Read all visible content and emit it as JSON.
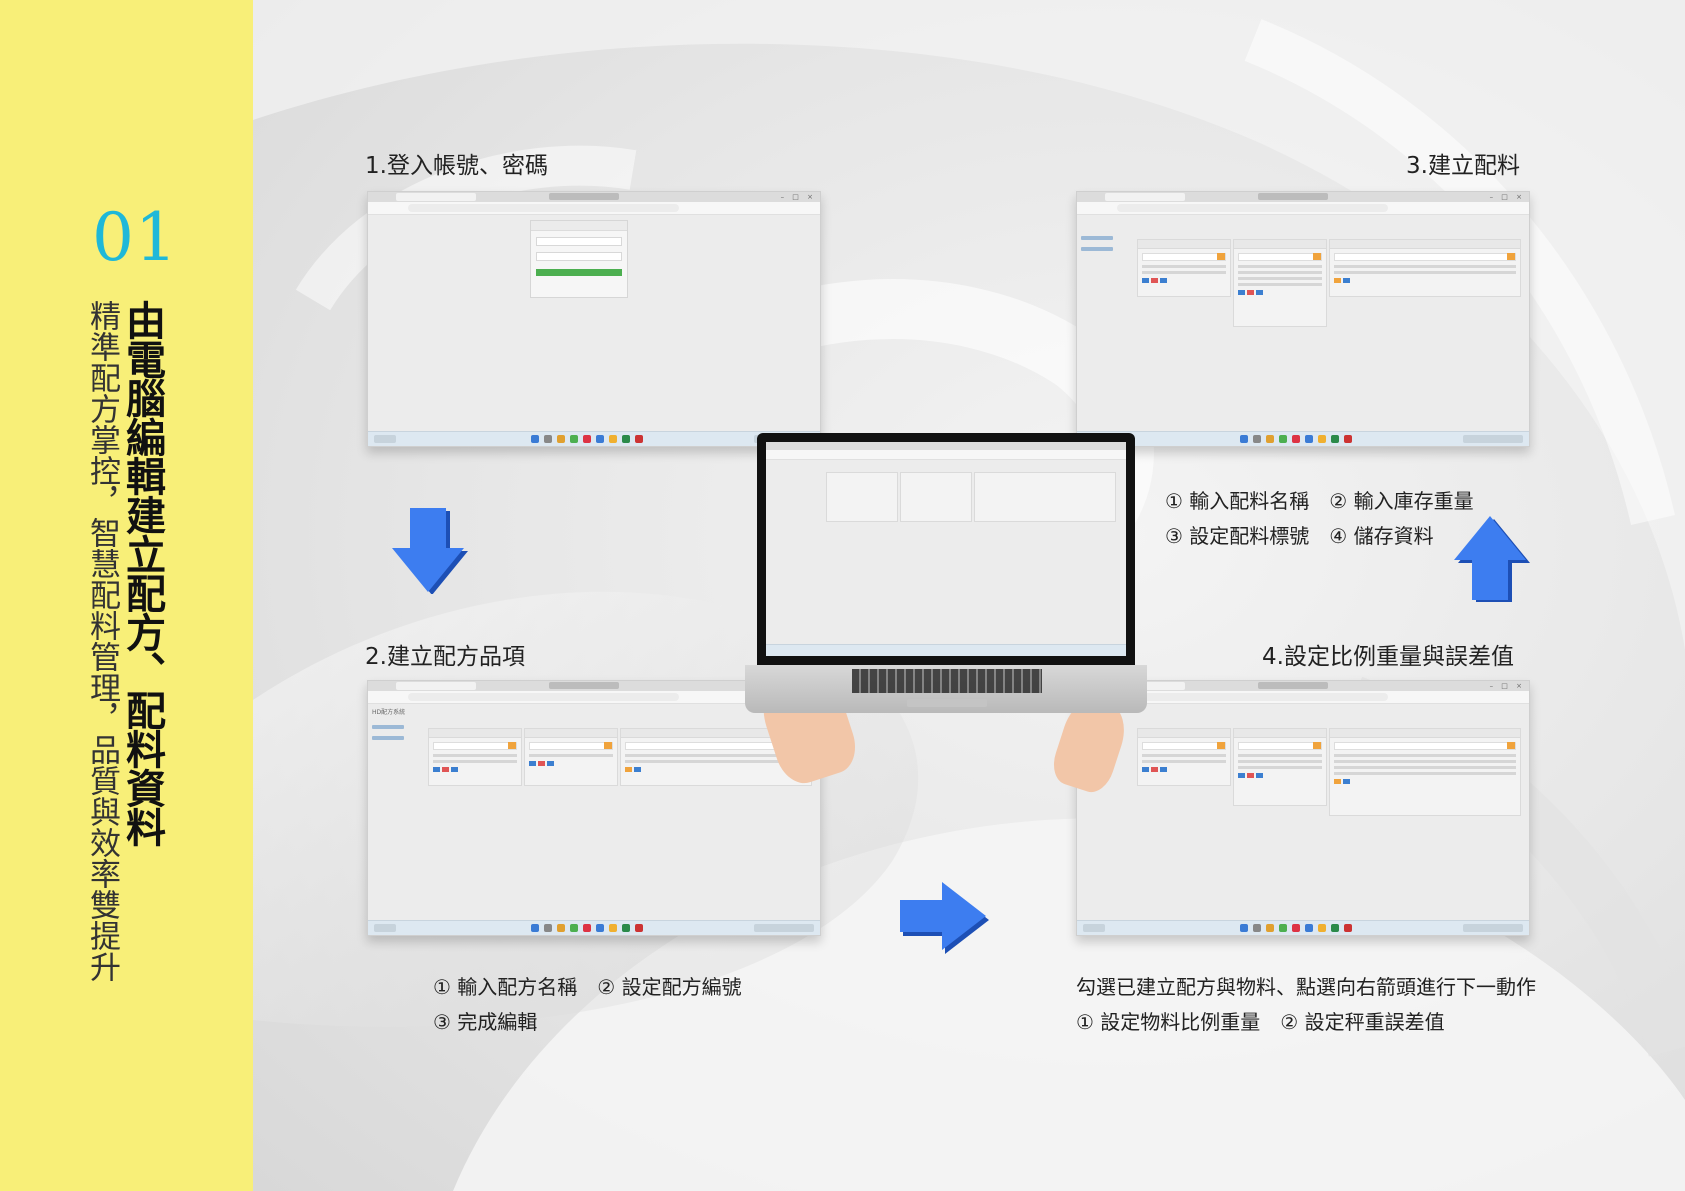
{
  "sidebar": {
    "number": "01",
    "title": "由電腦編輯建立配方、配料資料",
    "subtitle": "精準配方掌控，智慧配料管理，品質與效率雙提升"
  },
  "steps": {
    "step1": {
      "title": "1.登入帳號、密碼"
    },
    "step2": {
      "title": "2.建立配方品項",
      "notes": [
        "① 輸入配方名稱　② 設定配方編號",
        "③ 完成編輯"
      ]
    },
    "step3": {
      "title": "3.建立配料",
      "notes": [
        "① 輸入配料名稱　② 輸入庫存重量",
        "③ 設定配料標號　④ 儲存資料"
      ]
    },
    "step4": {
      "title": "4.設定比例重量與誤差值",
      "notes": [
        "勾選已建立配方與物料、點選向右箭頭進行下一動作",
        "① 設定物料比例重量　② 設定秤重誤差值"
      ]
    }
  },
  "colors": {
    "sidebar_bg": "#f8ef78",
    "number": "#1fb8d8",
    "arrow": "#2f6fe0"
  },
  "icons": [
    "arrow-down-icon",
    "arrow-up-icon",
    "arrow-right-icon"
  ]
}
